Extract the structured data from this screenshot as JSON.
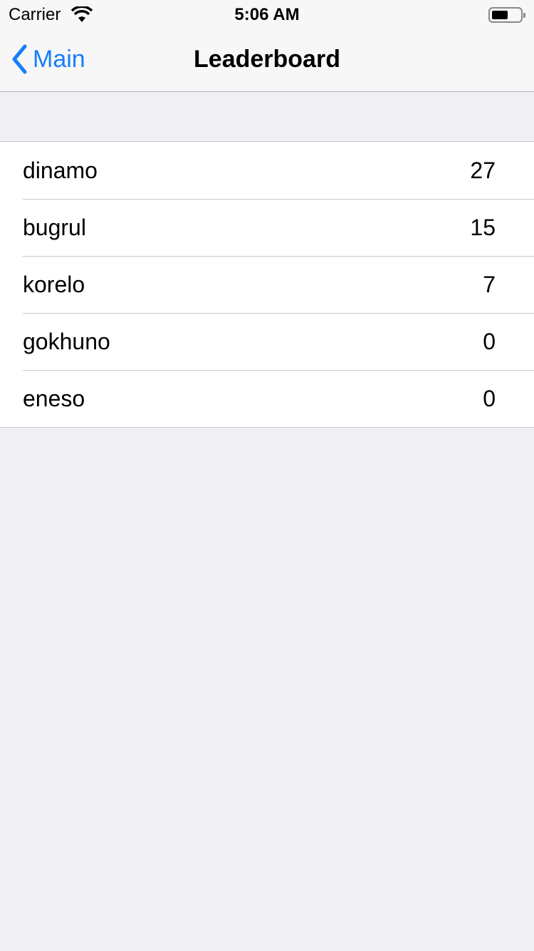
{
  "status_bar": {
    "carrier": "Carrier",
    "time": "5:06 AM"
  },
  "nav": {
    "back_label": "Main",
    "title": "Leaderboard"
  },
  "leaderboard": [
    {
      "name": "dinamo",
      "score": "27"
    },
    {
      "name": "bugrul",
      "score": "15"
    },
    {
      "name": "korelo",
      "score": "7"
    },
    {
      "name": "gokhuno",
      "score": "0"
    },
    {
      "name": "eneso",
      "score": "0"
    }
  ],
  "colors": {
    "accent": "#157efb",
    "background": "#efeff4"
  }
}
